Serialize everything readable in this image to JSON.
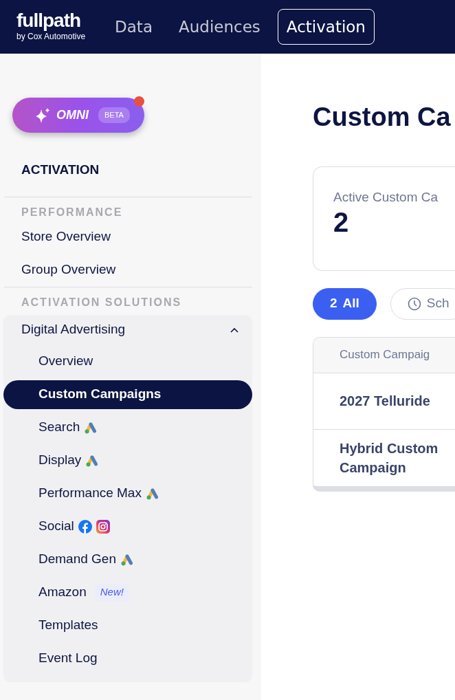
{
  "header": {
    "logo": "fullpath",
    "logo_sub": "by Cox Automotive",
    "nav": [
      {
        "label": "Data",
        "selected": false
      },
      {
        "label": "Audiences",
        "selected": false
      },
      {
        "label": "Activation",
        "selected": true
      }
    ]
  },
  "omni": {
    "label": "OMNI",
    "badge": "BETA",
    "notification": true
  },
  "sidebar": {
    "title": "ACTIVATION",
    "sections": [
      {
        "heading": "PERFORMANCE",
        "items": [
          {
            "label": "Store Overview",
            "selected": false
          },
          {
            "label": "Group Overview",
            "selected": false
          }
        ]
      },
      {
        "heading": "ACTIVATION SOLUTIONS",
        "items": [
          {
            "label": "Digital Advertising",
            "selected": false,
            "expanded": true,
            "children": [
              {
                "label": "Overview",
                "selected": false,
                "kind": "plain"
              },
              {
                "label": "Custom Campaigns",
                "selected": true,
                "kind": "plain"
              },
              {
                "label": "Search",
                "selected": false,
                "kind": "ads"
              },
              {
                "label": "Display",
                "selected": false,
                "kind": "ads"
              },
              {
                "label": "Performance Max",
                "selected": false,
                "kind": "ads"
              },
              {
                "label": "Social",
                "selected": false,
                "kind": "social"
              },
              {
                "label": "Demand Gen",
                "selected": false,
                "kind": "ads"
              },
              {
                "label": "Amazon",
                "selected": false,
                "kind": "badge",
                "badge": "New!"
              },
              {
                "label": "Templates",
                "selected": false,
                "kind": "plain"
              },
              {
                "label": "Event Log",
                "selected": false,
                "kind": "plain"
              }
            ]
          }
        ]
      }
    ]
  },
  "main": {
    "title": "Custom Ca",
    "stat": {
      "label": "Active Custom Ca",
      "value": "2"
    },
    "filters": [
      {
        "kind": "count",
        "count": "2",
        "label": "All",
        "selected": true
      },
      {
        "kind": "clock",
        "label": "Sch",
        "selected": false
      }
    ],
    "table": {
      "columns": [
        "Custom Campaig"
      ],
      "rows": [
        [
          "2027 Telluride"
        ],
        [
          "Hybrid Custom Campaign"
        ]
      ]
    }
  }
}
